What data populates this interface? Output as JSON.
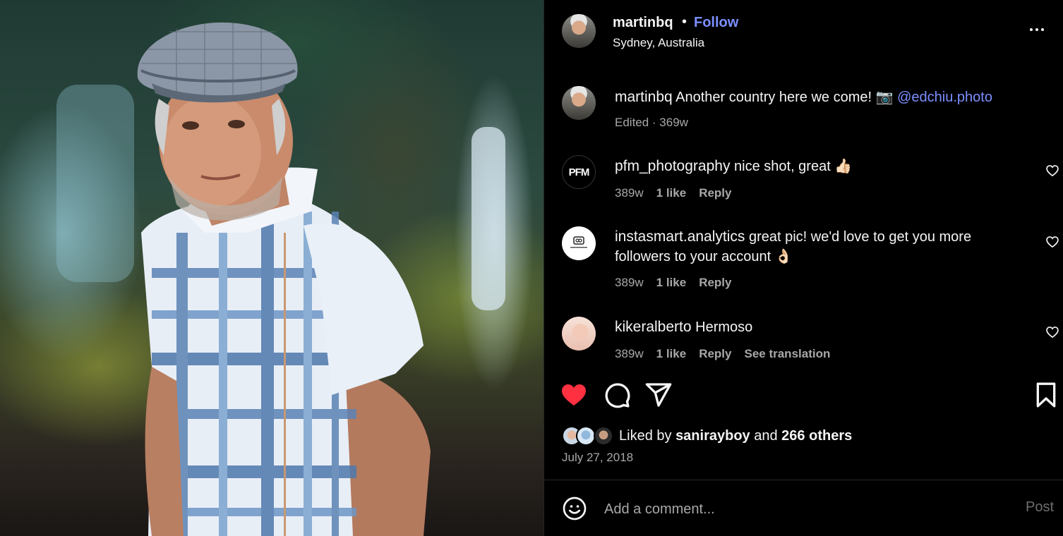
{
  "post": {
    "author": "martinbq",
    "separator": "•",
    "follow_label": "Follow",
    "location": "Sydney, Australia",
    "more_icon": "more-horizontal-icon"
  },
  "caption": {
    "user": "martinbq",
    "text": "Another country here we come! 📷",
    "mention": "@edchiu.photo",
    "edited": "Edited · 369w"
  },
  "comments": [
    {
      "user": "pfm_photography",
      "avatar_text": "PFM",
      "text": "nice shot, great 👍🏻",
      "time": "389w",
      "likes": "1 like",
      "reply": "Reply"
    },
    {
      "user": "instasmart.analytics",
      "text": "great pic! we'd love to get you more followers to your account 👌🏻",
      "time": "389w",
      "likes": "1 like",
      "reply": "Reply"
    },
    {
      "user": "kikeralberto",
      "text": "Hermoso",
      "time": "389w",
      "likes": "1 like",
      "reply": "Reply",
      "translation": "See translation"
    }
  ],
  "actions": {
    "liked": true,
    "like_color": "#ff3040",
    "icons": [
      "heart-icon",
      "comment-icon",
      "share-icon",
      "bookmark-icon"
    ]
  },
  "likes": {
    "prefix": "Liked by",
    "user": "sanirayboy",
    "middle": "and",
    "others": "266 others"
  },
  "date": "July 27, 2018",
  "composer": {
    "placeholder": "Add a comment...",
    "post_label": "Post"
  },
  "colors": {
    "background": "#000000",
    "text": "#f5f5f5",
    "secondary": "#a8a8a8",
    "link": "#7c8fff",
    "divider": "#262626"
  }
}
